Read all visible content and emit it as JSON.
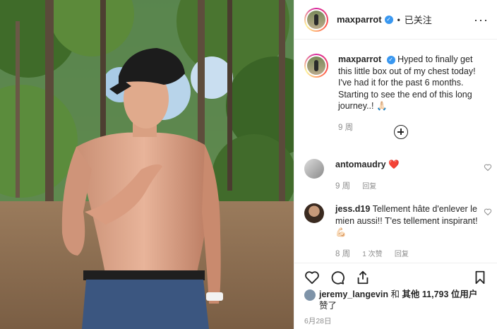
{
  "header": {
    "username": "maxparrot",
    "follow_label": "已关注",
    "separator": "•",
    "more": "···"
  },
  "caption": {
    "username": "maxparrot",
    "text": "Hyped to finally get this little box out of my chest today! I've had it for the past 6 months. Starting to see the end of this long journey..! 🙏🏻",
    "age": "9 周"
  },
  "comments": [
    {
      "username": "antomaudry",
      "text": "❤️",
      "age": "9 周",
      "likes": "",
      "reply_label": "回复"
    },
    {
      "username": "jess.d19",
      "text": "Tellement hâte d'enlever le mien aussi!! T'es tellement inspirant! 💪🏻",
      "age": "8 周",
      "likes": "1 次赞",
      "reply_label": "回复"
    }
  ],
  "likes": {
    "user": "jeremy_langevin",
    "text_middle": " 和 ",
    "others": "其他 11,793 位用户",
    "suffix": "赞了"
  },
  "date": "6月28日",
  "icons": [
    "more-icon",
    "verified-icon",
    "plus-circle-icon",
    "heart-icon",
    "comment-icon",
    "share-icon",
    "bookmark-icon"
  ]
}
